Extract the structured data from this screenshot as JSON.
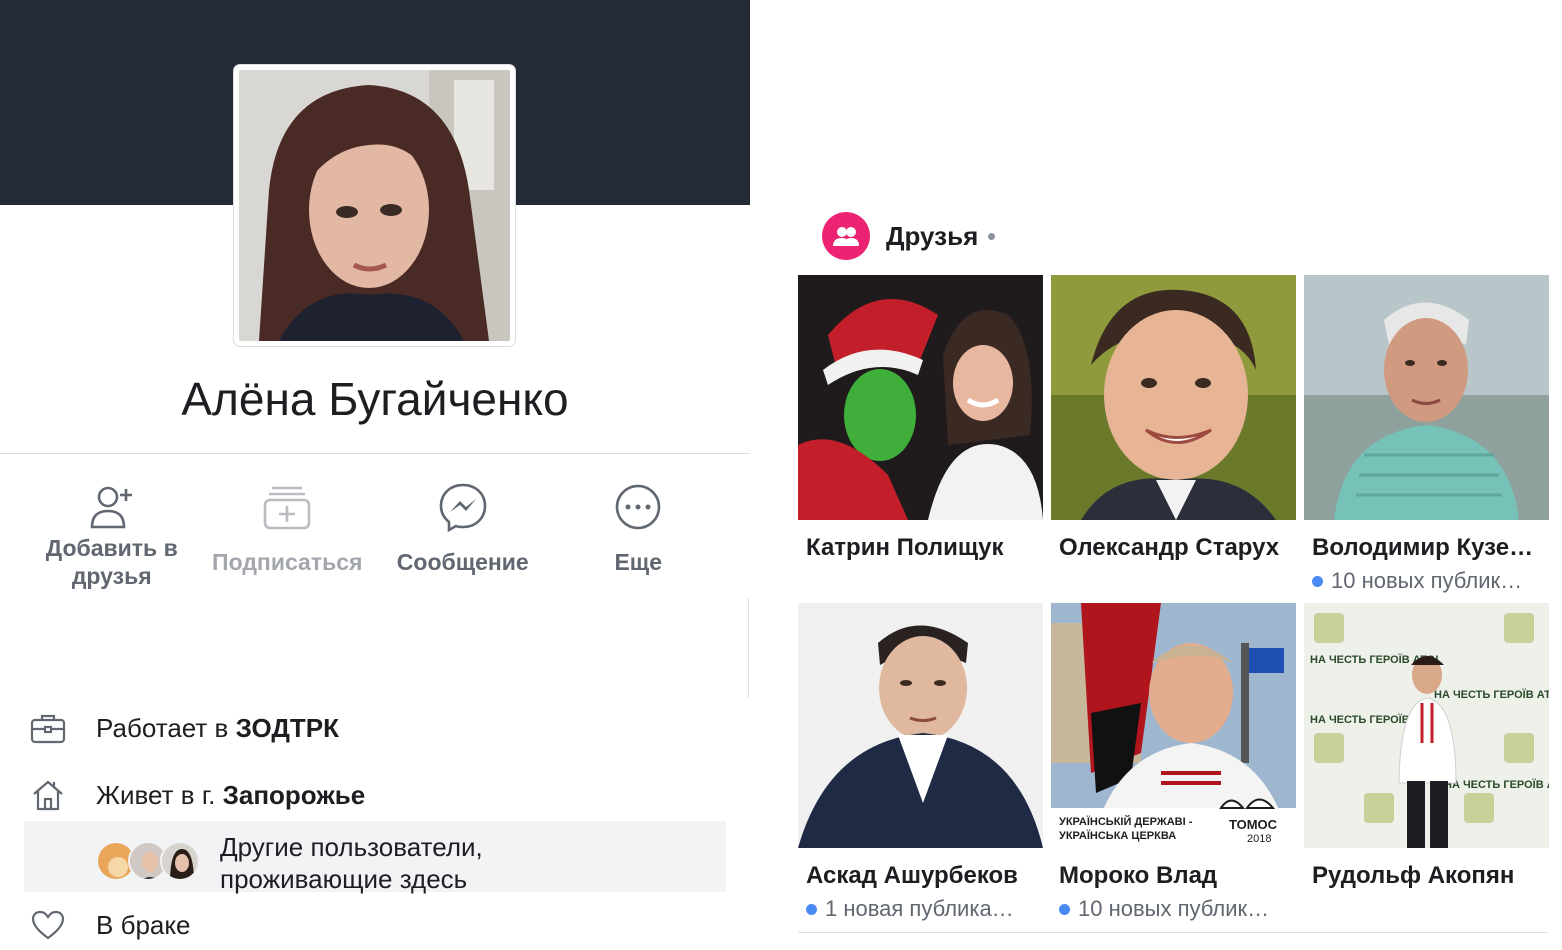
{
  "profile": {
    "name": "Алёна Бугайченко"
  },
  "actions": [
    {
      "label": "Добавить в друзья",
      "icon": "add-friend-icon",
      "enabled": true
    },
    {
      "label": "Подписаться",
      "icon": "follow-icon",
      "enabled": false
    },
    {
      "label": "Сообщение",
      "icon": "messenger-icon",
      "enabled": true
    },
    {
      "label": "Еще",
      "icon": "more-icon",
      "enabled": true
    }
  ],
  "info": {
    "work_prefix": "Работает в ",
    "work_place": "ЗОДТРК",
    "home_prefix": "Живет в г. ",
    "home_city": "Запорожье",
    "other_users_line1": "Другие пользователи,",
    "other_users_line2": "проживающие здесь",
    "relationship": "В браке"
  },
  "friends": {
    "title": "Друзья",
    "items": [
      {
        "name": "Катрин Полищук",
        "sub": ""
      },
      {
        "name": "Олександр Старух",
        "sub": ""
      },
      {
        "name": "Володимир Кузе…",
        "sub": "10 новых публик…"
      },
      {
        "name": "Аскад Ашурбеков",
        "sub": "1 новая публика…"
      },
      {
        "name": "Мороко Влад",
        "sub": "10 новых публик…"
      },
      {
        "name": "Рудольф Акопян",
        "sub": ""
      }
    ],
    "tomos_caption_line1": "УКРАЇНСЬКІЙ ДЕРЖАВІ -",
    "tomos_caption_line2": "УКРАЇНСЬКА ЦЕРКВА",
    "tomos_word": "ТОМОС",
    "tomos_year": "2018",
    "banner_text": "НА ЧЕСТЬ ГЕРОЇВ АТО!"
  },
  "colors": {
    "cover": "#252a37",
    "friends_badge": "#ec2273",
    "new_posts_dot": "#4a8af4",
    "secondary_text": "#606770"
  }
}
